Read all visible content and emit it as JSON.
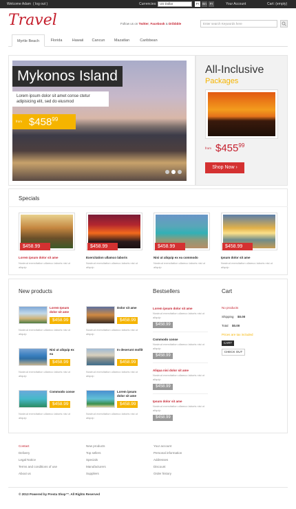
{
  "topbar": {
    "welcome": "Welcome Adam",
    "logout": "( log out )",
    "currencies_label": "Currencies:",
    "currency_value": "US Dollar",
    "currency_buttons": [
      "Fr",
      "En",
      "Fr"
    ],
    "account": "Your Account",
    "cart": "Cart: (empty)"
  },
  "header": {
    "logo": "Travel",
    "follow_prefix": "Follow us on",
    "follow_links": [
      "Twitter",
      "Facebook",
      "Dribbble"
    ],
    "search_placeholder": "Enter search Keywords here"
  },
  "nav": {
    "tabs": [
      "Myrtle Beach",
      "Florida",
      "Hawaii",
      "Cancun",
      "Mazatlan",
      "Caribbean"
    ]
  },
  "hero": {
    "title": "Mykonos Island",
    "text": "Lorem ipsum dolor sit amet conse ctetur adipisicing elit, sed do eiusmod",
    "from": "from",
    "price": "$458",
    "cents": "99"
  },
  "promo": {
    "title": "All-Inclusive",
    "subtitle": "Packages",
    "from": "from",
    "price": "$455",
    "cents": "99",
    "button": "Shop Now ›"
  },
  "specials": {
    "title": "Specials",
    "items": [
      {
        "price": "$458.99",
        "name": "Lorem ipsum dolor sit ame",
        "desc": "Nostrud exercitation ullamco laboris nisi ut aliquip"
      },
      {
        "price": "$458.99",
        "name": "Exercitation ullamco laboris",
        "desc": "Nostrud exercitation ullamco laboris nisi ut aliquip"
      },
      {
        "price": "$458.99",
        "name": "Nisi ut aliquip ex ea commodo",
        "desc": "Nostrud exercitation ullamco laboris nisi ut aliquip"
      },
      {
        "price": "$458.99",
        "name": "Ipsum dolor sit ame",
        "desc": "Nostrud exercitation ullamco laboris nisi ut aliquip"
      }
    ]
  },
  "new_products": {
    "title": "New products",
    "items": [
      {
        "name": "Lorem Ipsum dolor sit ame",
        "price": "$458.99",
        "desc": "Nostrud exercitation ullamco laboris nisi ut aliquip"
      },
      {
        "name": "Dolor sit ame",
        "price": "$458.99",
        "desc": "Nostrud exercitation ullamco laboris nisi ut aliquip"
      },
      {
        "name": "Nisi ut aliquip ex ea",
        "price": "$458.99",
        "desc": "Nostrud exercitation ullamco laboris nisi ut aliquip"
      },
      {
        "name": "In deserunt mollit",
        "price": "$458.99",
        "desc": "Nostrud exercitation ullamco laboris nisi ut aliquip"
      },
      {
        "name": "Commodo conse",
        "price": "$458.99",
        "desc": "Nostrud exercitation ullamco laboris nisi ut aliquip"
      },
      {
        "name": "Lorem ipsum dolor sit ame",
        "price": "$458.99",
        "desc": "Nostrud exercitation ullamco laboris nisi ut aliquip"
      }
    ]
  },
  "bestsellers": {
    "title": "Bestsellers",
    "items": [
      {
        "name": "Lorem ipsum dolor sit ame",
        "desc": "Nostrud exercitation ullamco laboris nisi ut aliquip",
        "price": "$458.99"
      },
      {
        "name": "Commodo conse",
        "desc": "Nostrud exercitation ullamco laboris nisi ut aliquip",
        "price": "$458.99"
      },
      {
        "name": "Aliqua nisi dolor sit ame",
        "desc": "Nostrud exercitation ullamco laboris nisi ut aliquip",
        "price": "$458.99"
      },
      {
        "name": "Ipsum dolor sit ame",
        "desc": "Nostrud exercitation ullamco laboris nisi ut aliquip",
        "price": "$458.99"
      }
    ]
  },
  "cart": {
    "title": "Cart",
    "no_products": "No products",
    "shipping_label": "Shipping",
    "shipping_value": "$0.00",
    "total_label": "Total",
    "total_value": "$0.00",
    "tax_note": "Prices are tax included",
    "cart_button": "CART",
    "checkout_button": "CHECK OUT"
  },
  "footer": {
    "col1": [
      "Contact",
      "Delivery",
      "Legal Notice",
      "Terms and conditions of use",
      "About us"
    ],
    "col2": [
      "New products",
      "Top sellers",
      "Specials",
      "Manufacturers",
      "Suppliers"
    ],
    "col3": [
      "Your account",
      "Personal information",
      "Addresses",
      "Discount",
      "Order history"
    ],
    "copyright": "© 2013 Powered by Presta Shop™. All Rights Reserved"
  },
  "colors": {
    "accent": "#c41e2c",
    "yellow": "#f5b400",
    "dark": "#2b2b2b"
  }
}
